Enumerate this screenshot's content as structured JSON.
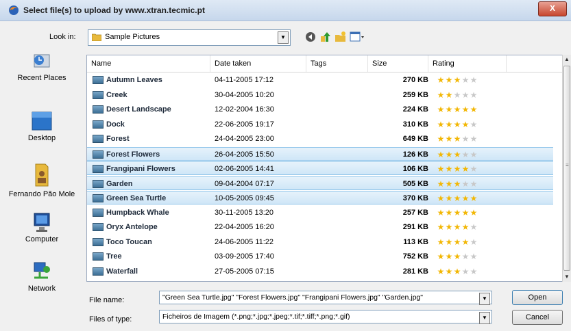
{
  "window": {
    "title": "Select file(s) to upload by www.xtran.tecmic.pt",
    "close_label": "X"
  },
  "lookin": {
    "label": "Look in:",
    "value": "Sample Pictures"
  },
  "places": [
    {
      "label": "Recent Places",
      "icon": "recent-places-icon"
    },
    {
      "label": "Desktop",
      "icon": "desktop-icon"
    },
    {
      "label": "Fernando Pão Mole",
      "icon": "user-folder-icon"
    },
    {
      "label": "Computer",
      "icon": "computer-icon"
    },
    {
      "label": "Network",
      "icon": "network-icon"
    }
  ],
  "columns": {
    "name": "Name",
    "date": "Date taken",
    "tags": "Tags",
    "size": "Size",
    "rating": "Rating"
  },
  "files": [
    {
      "name": "Autumn Leaves",
      "date": "04-11-2005 17:12",
      "size": "270 KB",
      "rating": 3,
      "selected": false
    },
    {
      "name": "Creek",
      "date": "30-04-2005 10:20",
      "size": "259 KB",
      "rating": 2,
      "selected": false
    },
    {
      "name": "Desert Landscape",
      "date": "12-02-2004 16:30",
      "size": "224 KB",
      "rating": 5,
      "selected": false
    },
    {
      "name": "Dock",
      "date": "22-06-2005 19:17",
      "size": "310 KB",
      "rating": 4,
      "selected": false
    },
    {
      "name": "Forest",
      "date": "24-04-2005 23:00",
      "size": "649 KB",
      "rating": 3,
      "selected": false
    },
    {
      "name": "Forest Flowers",
      "date": "26-04-2005 15:50",
      "size": "126 KB",
      "rating": 3,
      "selected": true
    },
    {
      "name": "Frangipani Flowers",
      "date": "02-06-2005 14:41",
      "size": "106 KB",
      "rating": 4,
      "selected": true
    },
    {
      "name": "Garden",
      "date": "09-04-2004 07:17",
      "size": "505 KB",
      "rating": 3,
      "selected": true
    },
    {
      "name": "Green Sea Turtle",
      "date": "10-05-2005 09:45",
      "size": "370 KB",
      "rating": 5,
      "selected": true
    },
    {
      "name": "Humpback Whale",
      "date": "30-11-2005 13:20",
      "size": "257 KB",
      "rating": 5,
      "selected": false
    },
    {
      "name": "Oryx Antelope",
      "date": "22-04-2005 16:20",
      "size": "291 KB",
      "rating": 4,
      "selected": false
    },
    {
      "name": "Toco Toucan",
      "date": "24-06-2005 11:22",
      "size": "113 KB",
      "rating": 4,
      "selected": false
    },
    {
      "name": "Tree",
      "date": "03-09-2005 17:40",
      "size": "752 KB",
      "rating": 3,
      "selected": false
    },
    {
      "name": "Waterfall",
      "date": "27-05-2005 07:15",
      "size": "281 KB",
      "rating": 3,
      "selected": false
    }
  ],
  "filename": {
    "label": "File name:",
    "value": "\"Green Sea Turtle.jpg\" \"Forest Flowers.jpg\" \"Frangipani Flowers.jpg\" \"Garden.jpg\""
  },
  "filetype": {
    "label": "Files of type:",
    "value": "Ficheiros de Imagem (*.png;*.jpg;*.jpeg;*.tif;*.tiff;*.png;*.gif)"
  },
  "buttons": {
    "open": "Open",
    "cancel": "Cancel"
  },
  "colors": {
    "selection": "#cfe6f7",
    "star_on": "#f2b705",
    "star_off": "#c8c8c8"
  }
}
